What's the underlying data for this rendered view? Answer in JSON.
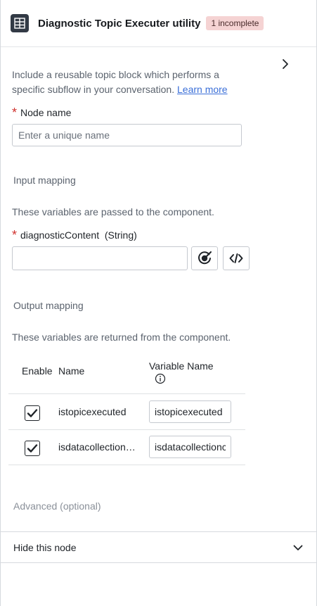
{
  "header": {
    "title": "Diagnostic Topic Executer utility",
    "badge": "1 incomplete"
  },
  "description": {
    "text": "Include a reusable topic block which performs a specific subflow in your conversation. ",
    "link": "Learn more"
  },
  "node_name": {
    "label": "Node name",
    "value": "",
    "placeholder": "Enter a unique name"
  },
  "input_mapping": {
    "title": "Input mapping",
    "description": "These variables are passed to the component.",
    "field_label": "diagnosticContent  (String)",
    "field_value": ""
  },
  "output_mapping": {
    "title": "Output mapping",
    "description": "These variables are returned from the component.",
    "columns": {
      "enable": "Enable",
      "name": "Name",
      "variable_name": "Variable Name"
    },
    "rows": [
      {
        "checked": true,
        "name": "istopicexecuted",
        "variable": "istopicexecuted"
      },
      {
        "checked": true,
        "name": "isdatacollectioncompleted",
        "variable": "isdatacollectioncompleted"
      }
    ]
  },
  "advanced": {
    "label": "Advanced (optional)"
  },
  "hide_node": {
    "label": "Hide this node"
  },
  "icons": {
    "header": "table-grid-icon",
    "expand": "chevron-right-icon",
    "variable_picker": "target-icon",
    "code": "code-icon",
    "info": "info-icon",
    "collapse": "chevron-down-icon"
  }
}
